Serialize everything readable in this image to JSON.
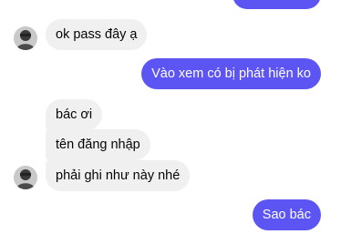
{
  "chat": {
    "messages": [
      {
        "sender": "other",
        "text": "ok pass đây ạ"
      },
      {
        "sender": "me",
        "text": "Vào xem có bị phát hiện ko"
      },
      {
        "sender": "other",
        "text": "bác ơi"
      },
      {
        "sender": "other",
        "text": "tên đăng nhập"
      },
      {
        "sender": "other",
        "text": "phải ghi như này nhé"
      },
      {
        "sender": "me",
        "text": "Sao bác"
      }
    ]
  },
  "colors": {
    "sent_bubble": "#5c55f4",
    "received_bubble": "#f0f0f0",
    "background": "#ffffff"
  }
}
